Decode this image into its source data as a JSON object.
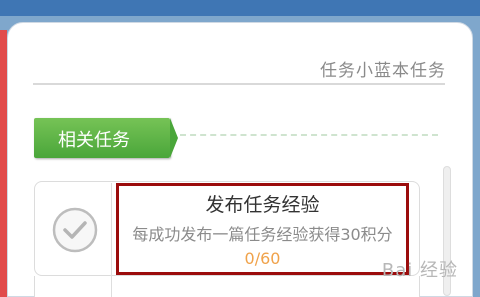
{
  "panel": {
    "title": "任务小蓝本任务"
  },
  "section": {
    "label": "相关任务"
  },
  "task": {
    "title": "发布任务经验",
    "description": "每成功发布一篇任务经验获得30积分",
    "progress": "0/60",
    "status_icon": "check-circle-icon"
  },
  "watermark": {
    "text": "Bai 经验"
  },
  "colors": {
    "top_bar": "#3f76b4",
    "left_accent": "#e14b4b",
    "tab_green": "#5ab946",
    "highlight_red": "#9b0c0c",
    "progress_orange": "#f0a24a"
  }
}
